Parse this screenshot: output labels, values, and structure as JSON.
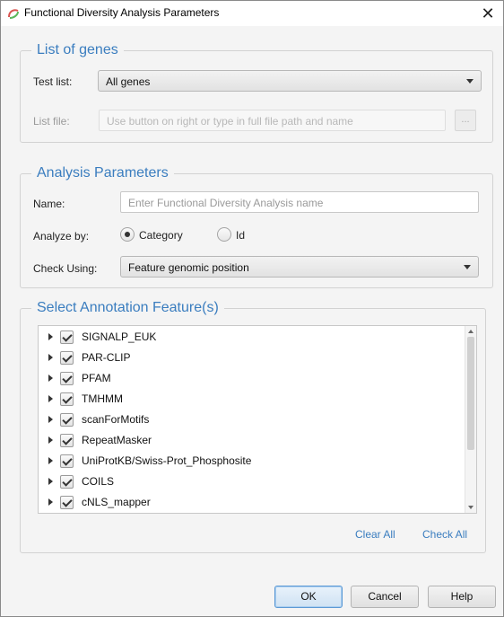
{
  "window": {
    "title": "Functional Diversity Analysis Parameters",
    "close_glyph": "✕",
    "icon": "app-logo-icon"
  },
  "gene_list": {
    "legend": "List of genes",
    "test_list_label": "Test list:",
    "test_list_value": "All genes",
    "list_file_label": "List file:",
    "list_file_placeholder": "Use button on right or type in full file path and name",
    "browse_label": "..."
  },
  "analysis": {
    "legend": "Analysis Parameters",
    "name_label": "Name:",
    "name_placeholder": "Enter Functional Diversity Analysis name",
    "analyze_by_label": "Analyze by:",
    "analyze_options": [
      "Category",
      "Id"
    ],
    "analyze_selected": "Category",
    "check_using_label": "Check Using:",
    "check_using_value": "Feature genomic position"
  },
  "features": {
    "legend": "Select Annotation Feature(s)",
    "items": [
      {
        "label": "SIGNALP_EUK",
        "checked": true
      },
      {
        "label": "PAR-CLIP",
        "checked": true
      },
      {
        "label": "PFAM",
        "checked": true
      },
      {
        "label": "TMHMM",
        "checked": true
      },
      {
        "label": "scanForMotifs",
        "checked": true
      },
      {
        "label": "RepeatMasker",
        "checked": true
      },
      {
        "label": "UniProtKB/Swiss-Prot_Phosphosite",
        "checked": true
      },
      {
        "label": "COILS",
        "checked": true
      },
      {
        "label": "cNLS_mapper",
        "checked": true
      }
    ],
    "clear_all": "Clear All",
    "check_all": "Check All"
  },
  "buttons": {
    "ok": "OK",
    "cancel": "Cancel",
    "help": "Help"
  },
  "colors": {
    "accent": "#3a7dbf",
    "default_button_border": "#5c9ad5"
  }
}
